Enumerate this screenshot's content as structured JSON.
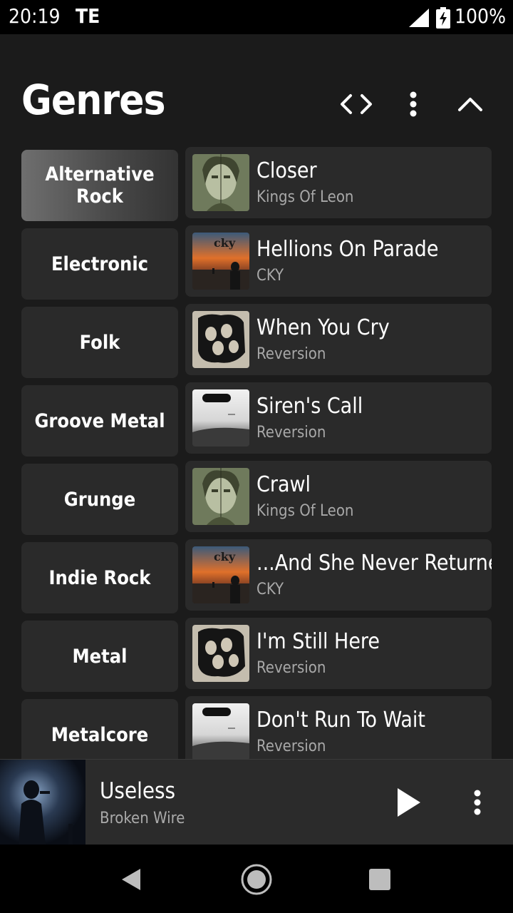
{
  "status": {
    "time": "20:19",
    "carrier_glyph": "TE",
    "battery": "100%"
  },
  "header": {
    "title": "Genres",
    "icons": [
      "code-arrows-icon",
      "more-vert-icon",
      "chevron-up-icon"
    ]
  },
  "genres": [
    {
      "label": "Alternative Rock",
      "selected": true
    },
    {
      "label": "Electronic"
    },
    {
      "label": "Folk"
    },
    {
      "label": "Groove Metal"
    },
    {
      "label": "Grunge"
    },
    {
      "label": "Indie Rock"
    },
    {
      "label": "Metal"
    },
    {
      "label": "Metalcore"
    }
  ],
  "songs": [
    {
      "title": "Closer",
      "artist": "Kings Of Leon"
    },
    {
      "title": "Hellions On Parade",
      "artist": "CKY"
    },
    {
      "title": "When You Cry",
      "artist": "Reversion"
    },
    {
      "title": "Siren's Call",
      "artist": "Reversion"
    },
    {
      "title": "Crawl",
      "artist": "Kings Of Leon"
    },
    {
      "title": "...And She Never Returned",
      "artist": "CKY"
    },
    {
      "title": "I'm Still Here",
      "artist": "Reversion"
    },
    {
      "title": "Don't Run To Wait",
      "artist": "Reversion"
    }
  ],
  "player": {
    "title": "Useless",
    "artist": "Broken Wire"
  },
  "nav": [
    "back-icon",
    "home-icon",
    "recents-icon"
  ]
}
